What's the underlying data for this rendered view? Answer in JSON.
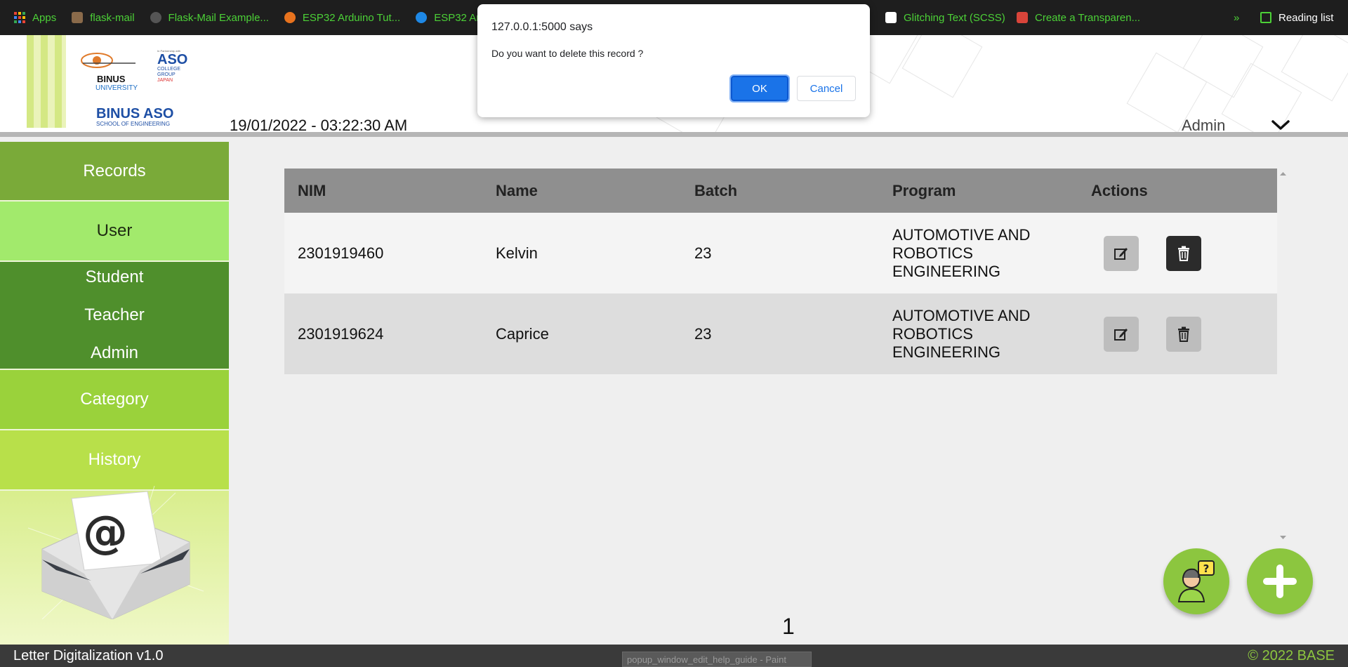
{
  "bookmarks": [
    {
      "label": "Apps",
      "icon": "apps-grid-icon"
    },
    {
      "label": "flask-mail",
      "icon": "avatar-icon"
    },
    {
      "label": "Flask-Mail Example...",
      "icon": "github-icon"
    },
    {
      "label": "ESP32 Arduino Tut...",
      "icon": "robot-icon"
    },
    {
      "label": "ESP32 Ard",
      "icon": "globe-icon"
    },
    {
      "label": "Glitching Text (SCSS)",
      "icon": "codepen-icon"
    },
    {
      "label": "Create a Transparen...",
      "icon": "wrench-icon"
    }
  ],
  "bookmarks_overflow": "»",
  "reading_list": "Reading list",
  "header": {
    "logo_binus": "BINUS",
    "logo_binus_sub": "UNIVERSITY",
    "logo_aso": "ASO",
    "logo_aso_sub1": "COLLEGE",
    "logo_aso_sub2": "GROUP",
    "logo_aso_sub3": "JAPAN",
    "logo_aso_partner": "In Partnership with",
    "logo_school": "BINUS ASO",
    "logo_school_sub": "SCHOOL OF ENGINEERING",
    "datetime": "19/01/2022 - 03:22:30 AM",
    "user": "Admin"
  },
  "sidebar": {
    "records": "Records",
    "user": "User",
    "submenu": [
      "Student",
      "Teacher",
      "Admin"
    ],
    "category": "Category",
    "history": "History"
  },
  "table": {
    "headers": [
      "NIM",
      "Name",
      "Batch",
      "Program",
      "Actions"
    ],
    "rows": [
      {
        "nim": "2301919460",
        "name": "Kelvin",
        "batch": "23",
        "program": [
          "AUTOMOTIVE AND",
          "ROBOTICS",
          "ENGINEERING"
        ]
      },
      {
        "nim": "2301919624",
        "name": "Caprice",
        "batch": "23",
        "program": [
          "AUTOMOTIVE AND",
          "ROBOTICS",
          "ENGINEERING"
        ]
      }
    ]
  },
  "pagination": {
    "current": "1"
  },
  "footer": {
    "title": "Letter Digitalization v1.0",
    "copyright": "© 2022 BASE",
    "taskbar_tooltip": "popup_window_edit_help_guide - Paint"
  },
  "dialog": {
    "origin": "127.0.0.1:5000 says",
    "message": "Do you want to delete this record ?",
    "ok": "OK",
    "cancel": "Cancel"
  },
  "colors": {
    "accent_green": "#8cc63f",
    "bookmark_text": "#4cd137",
    "dialog_blue": "#1a73e8"
  }
}
